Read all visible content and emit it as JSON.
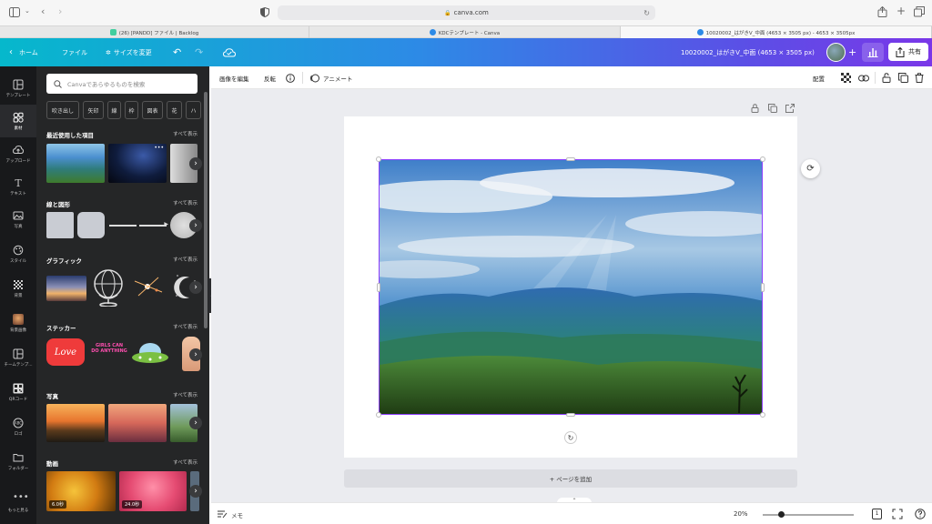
{
  "browser": {
    "url": "canva.com",
    "tabs": [
      {
        "label": "(26) [PANDD] ファイル | Backlog",
        "color": "#42ce9f"
      },
      {
        "label": "KDCテンプレート - Canva",
        "color": "#2d8ae6"
      },
      {
        "label": "10020002_はがきV_中面 (4653 × 3505 px) - 4653 × 3505px",
        "color": "#2d8ae6"
      }
    ]
  },
  "header": {
    "home": "ホーム",
    "file": "ファイル",
    "resize": "サイズを変更",
    "doc_title": "10020002_はがきV_中面 (4653 × 3505 px)",
    "share": "共有"
  },
  "rail": [
    {
      "label": "テンプレート",
      "icon": "template-icon"
    },
    {
      "label": "素材",
      "icon": "elements-icon"
    },
    {
      "label": "アップロード",
      "icon": "upload-icon"
    },
    {
      "label": "テキスト",
      "icon": "text-icon"
    },
    {
      "label": "写真",
      "icon": "photo-icon"
    },
    {
      "label": "スタイル",
      "icon": "style-icon"
    },
    {
      "label": "背景",
      "icon": "background-icon"
    },
    {
      "label": "背景画像",
      "icon": "bg-image-icon"
    },
    {
      "label": "チームテンプ...",
      "icon": "team-template-icon"
    },
    {
      "label": "QRコード",
      "icon": "qr-code-icon"
    },
    {
      "label": "ロゴ",
      "icon": "logo-icon"
    },
    {
      "label": "フォルダー",
      "icon": "folder-icon"
    },
    {
      "label": "もっと見る",
      "icon": "more-icon"
    }
  ],
  "panel": {
    "search_placeholder": "Canvaであらゆるものを検索",
    "chips": [
      "吹き出し",
      "矢印",
      "線",
      "枠",
      "図表",
      "花",
      "ハ"
    ],
    "see_all": "すべて表示",
    "sections": {
      "recent": "最近使用した項目",
      "shapes": "線と図形",
      "graphics": "グラフィック",
      "stickers": "ステッカー",
      "photos": "写真",
      "videos": "動画"
    },
    "sticker_text": {
      "love": "Love",
      "girls": "GIRLS CAN DO ANYTHING"
    },
    "video_durations": [
      "6.0秒",
      "24.0秒"
    ]
  },
  "toolbar": {
    "edit_image": "画像を編集",
    "flip": "反転",
    "animate": "アニメート",
    "position": "配置"
  },
  "editor": {
    "add_page": "+ ページを追加"
  },
  "footer": {
    "notes": "メモ",
    "zoom": "20%",
    "zoom_level": 0.2,
    "page_count": "1"
  }
}
